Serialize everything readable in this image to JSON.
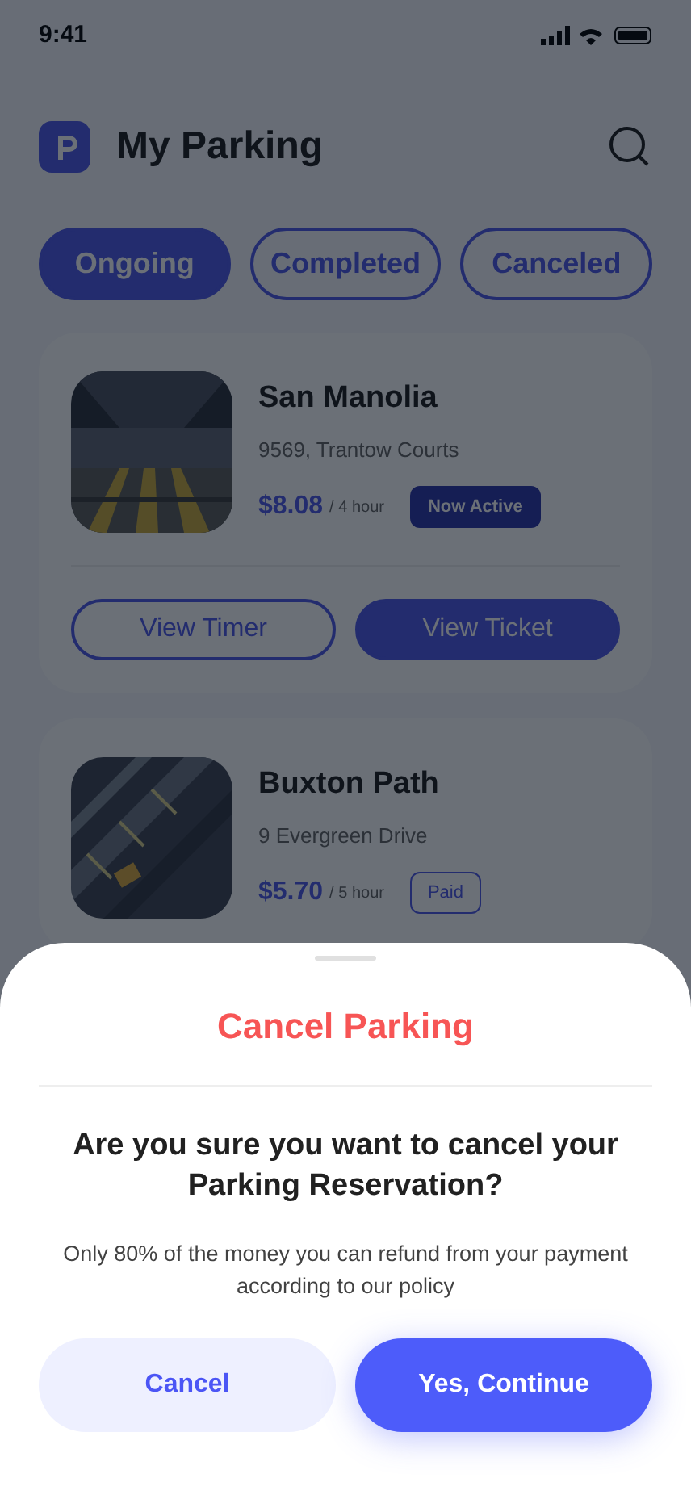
{
  "status_bar": {
    "time": "9:41"
  },
  "header": {
    "title": "My Parking"
  },
  "tabs": [
    {
      "label": "Ongoing",
      "selected": true
    },
    {
      "label": "Completed",
      "selected": false
    },
    {
      "label": "Canceled",
      "selected": false
    }
  ],
  "bookings": [
    {
      "name": "San Manolia",
      "address": "9569, Trantow Courts",
      "price": "$8.08",
      "unit": "/ 4 hour",
      "badge": {
        "kind": "active",
        "label": "Now Active"
      },
      "picture": {
        "kind": "picture"
      },
      "actions": [
        "View Timer",
        "View Ticket"
      ]
    },
    {
      "name": "Buxton Path",
      "address": "9 Evergreen Drive",
      "price": "$5.70",
      "unit": "/ 5 hour",
      "badge": {
        "kind": "paid",
        "label": "Paid"
      },
      "picture": {
        "kind": "picture"
      }
    }
  ],
  "sheet": {
    "title": "Cancel Parking",
    "question": "Are you sure you want to cancel your Parking Reservation?",
    "note": "Only 80% of the money you can refund from your payment according to our policy",
    "buttons": [
      {
        "kind": "secondary",
        "label": "Cancel"
      },
      {
        "kind": "primary",
        "label": "Yes, Continue"
      }
    ]
  }
}
